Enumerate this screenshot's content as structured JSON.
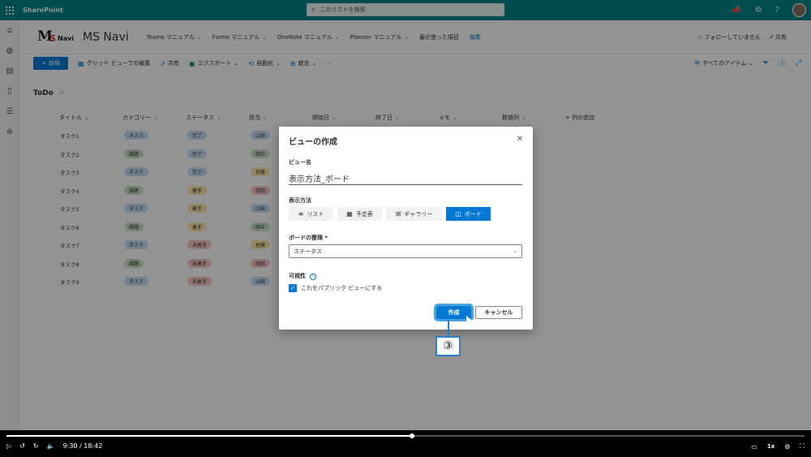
{
  "suite": {
    "title": "SharePoint",
    "search_placeholder": "このリストを検索"
  },
  "site": {
    "logo_m": "M",
    "logo_s": "S",
    "logo_navi": "Navi",
    "name": "MS Navi",
    "nav": [
      "Teams マニュアル",
      "Forms マニュアル",
      "OneNote マニュアル",
      "Planner マニュアル",
      "最近使った項目"
    ],
    "edit": "編集",
    "follow": "☆ フォローしていません",
    "share": "共有"
  },
  "cmdbar": {
    "new": "新規",
    "grid_edit": "グリッド ビューでの編集",
    "share": "共有",
    "export": "エクスポート",
    "automate": "自動化",
    "integrate": "統合",
    "more": "···",
    "view": "すべてのアイテム"
  },
  "list": {
    "title": "ToDo",
    "columns": [
      "タイトル",
      "カテゴリー",
      "ステータス",
      "担当",
      "開始日",
      "終了日",
      "メモ",
      "数値列",
      "+ 列の追加"
    ],
    "rows": [
      {
        "title": "タスク1",
        "category": "タスク",
        "status": "完了",
        "owner": "山田"
      },
      {
        "title": "タスク2",
        "category": "課題",
        "status": "完了",
        "owner": "田中"
      },
      {
        "title": "タスク3",
        "category": "タスク",
        "status": "完了",
        "owner": "佐藤"
      },
      {
        "title": "タスク4",
        "category": "課題",
        "status": "着手",
        "owner": "岡田"
      },
      {
        "title": "タスク5",
        "category": "タスク",
        "status": "着手",
        "owner": "山田"
      },
      {
        "title": "タスク6",
        "category": "課題",
        "status": "着手",
        "owner": "田中"
      },
      {
        "title": "タスク7",
        "category": "タスク",
        "status": "未着手",
        "owner": "佐藤"
      },
      {
        "title": "タスク8",
        "category": "課題",
        "status": "未着手",
        "owner": "岡田"
      },
      {
        "title": "タスク9",
        "category": "タスク",
        "status": "未着手",
        "owner": "山田"
      }
    ]
  },
  "colors": {
    "task": "#c7e0f4",
    "issue": "#c8e6c9",
    "done": "#c7e0f4",
    "started": "#fde7a9",
    "notstarted": "#f8c8c4",
    "山田": "#c7e0f4",
    "田中": "#c8e6c9",
    "佐藤": "#fde7a9",
    "岡田": "#f8c8c4"
  },
  "dialog": {
    "title": "ビューの作成",
    "name_label": "ビュー名",
    "name_value": "表示方法_ボード",
    "display_label": "表示方法",
    "views": [
      {
        "label": "リスト",
        "icon": "≡",
        "active": false
      },
      {
        "label": "予定表",
        "icon": "▦",
        "active": false
      },
      {
        "label": "ギャラリー",
        "icon": "⊞",
        "active": false
      },
      {
        "label": "ボード",
        "icon": "◫",
        "active": true
      }
    ],
    "organize_label": "ボードの整理 *",
    "organize_value": "ステータス",
    "visibility_label": "可視性",
    "public_label": "これをパブリック ビューにする",
    "create": "作成",
    "cancel": "キャンセル"
  },
  "callout": "③",
  "video": {
    "time": "9:30 / 18:42",
    "speed": "1x",
    "progress": 0.508
  }
}
